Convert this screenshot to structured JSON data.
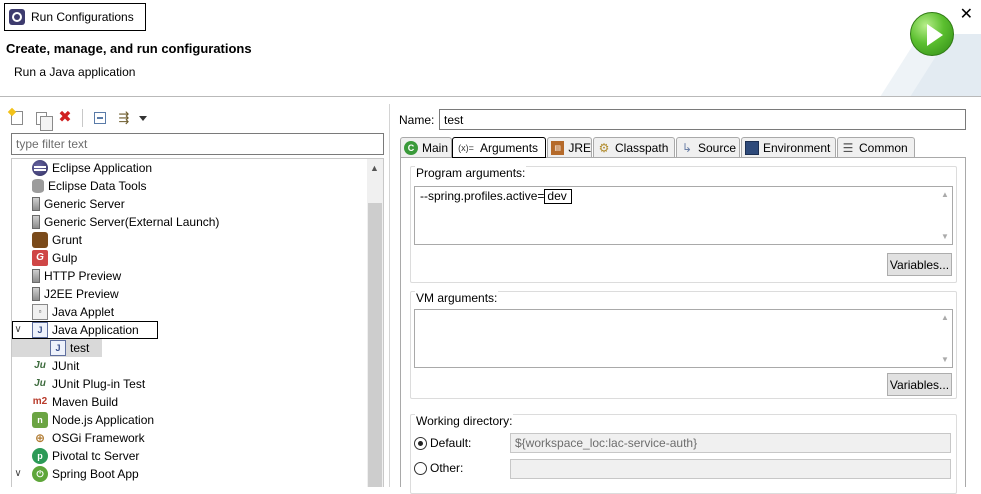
{
  "window": {
    "title": "Run Configurations",
    "close_glyph": "✕"
  },
  "header": {
    "title": "Create, manage, and run configurations",
    "subtitle": "Run a Java application",
    "icon": "run-icon"
  },
  "left_toolbar": {
    "buttons": [
      "new-configuration-icon",
      "duplicate-icon",
      "delete-icon",
      "collapse-all-icon",
      "filter-icon"
    ]
  },
  "filter": {
    "placeholder": "type filter text",
    "value": ""
  },
  "tree": {
    "items": [
      {
        "label": "Eclipse Application",
        "icon": "eclipse-icon",
        "glyph": ""
      },
      {
        "label": "Eclipse Data Tools",
        "icon": "database-icon",
        "glyph": ""
      },
      {
        "label": "Generic Server",
        "icon": "server-icon",
        "glyph": ""
      },
      {
        "label": "Generic Server(External Launch)",
        "icon": "server-icon",
        "glyph": ""
      },
      {
        "label": "Grunt",
        "icon": "grunt-icon",
        "glyph": ""
      },
      {
        "label": "Gulp",
        "icon": "gulp-icon",
        "glyph": "G"
      },
      {
        "label": "HTTP Preview",
        "icon": "server-icon",
        "glyph": ""
      },
      {
        "label": "J2EE Preview",
        "icon": "server-icon",
        "glyph": ""
      },
      {
        "label": "Java Applet",
        "icon": "applet-icon",
        "glyph": "▫"
      },
      {
        "label": "Java Application",
        "icon": "java-app-icon",
        "glyph": "J",
        "expanded": true
      },
      {
        "label": "test",
        "icon": "java-app-icon",
        "glyph": "J",
        "child": true
      },
      {
        "label": "JUnit",
        "icon": "junit-icon",
        "glyph": "Ju"
      },
      {
        "label": "JUnit Plug-in Test",
        "icon": "junit-icon",
        "glyph": "Ju"
      },
      {
        "label": "Maven Build",
        "icon": "maven-icon",
        "glyph": "m2"
      },
      {
        "label": "Node.js Application",
        "icon": "nodejs-icon",
        "glyph": "n"
      },
      {
        "label": "OSGi Framework",
        "icon": "osgi-icon",
        "glyph": "⊕"
      },
      {
        "label": "Pivotal tc Server",
        "icon": "pivotal-icon",
        "glyph": "p"
      },
      {
        "label": "Spring Boot App",
        "icon": "spring-boot-icon",
        "glyph": "⏻",
        "expanded": true
      }
    ]
  },
  "config": {
    "name_label": "Name:",
    "name_value": "test",
    "tabs": [
      {
        "label": "Main",
        "icon": "main-tab-icon",
        "glyph": "●"
      },
      {
        "label": "Arguments",
        "icon": "arguments-tab-icon",
        "glyph": "(x)="
      },
      {
        "label": "JRE",
        "icon": "jre-tab-icon",
        "glyph": "▤"
      },
      {
        "label": "Classpath",
        "icon": "classpath-tab-icon",
        "glyph": "⚙"
      },
      {
        "label": "Source",
        "icon": "source-tab-icon",
        "glyph": "↳"
      },
      {
        "label": "Environment",
        "icon": "environment-tab-icon",
        "glyph": "▣"
      },
      {
        "label": "Common",
        "icon": "common-tab-icon",
        "glyph": "☰"
      }
    ],
    "program_args": {
      "label": "Program arguments:",
      "value_prefix": "--spring.profiles.active=",
      "value_highlight": "dev",
      "variables_button": "Variables..."
    },
    "vm_args": {
      "label": "VM arguments:",
      "value": "",
      "variables_button": "Variables..."
    },
    "working_dir": {
      "label": "Working directory:",
      "default_label": "Default:",
      "default_value": "${workspace_loc:lac-service-auth}",
      "other_label": "Other:",
      "other_value": "",
      "selected": "default"
    }
  },
  "colors": {
    "run_button_green": "#5bbf2f",
    "selection_gray": "#d9d9d9",
    "tab_border": "#a9a9a9"
  }
}
